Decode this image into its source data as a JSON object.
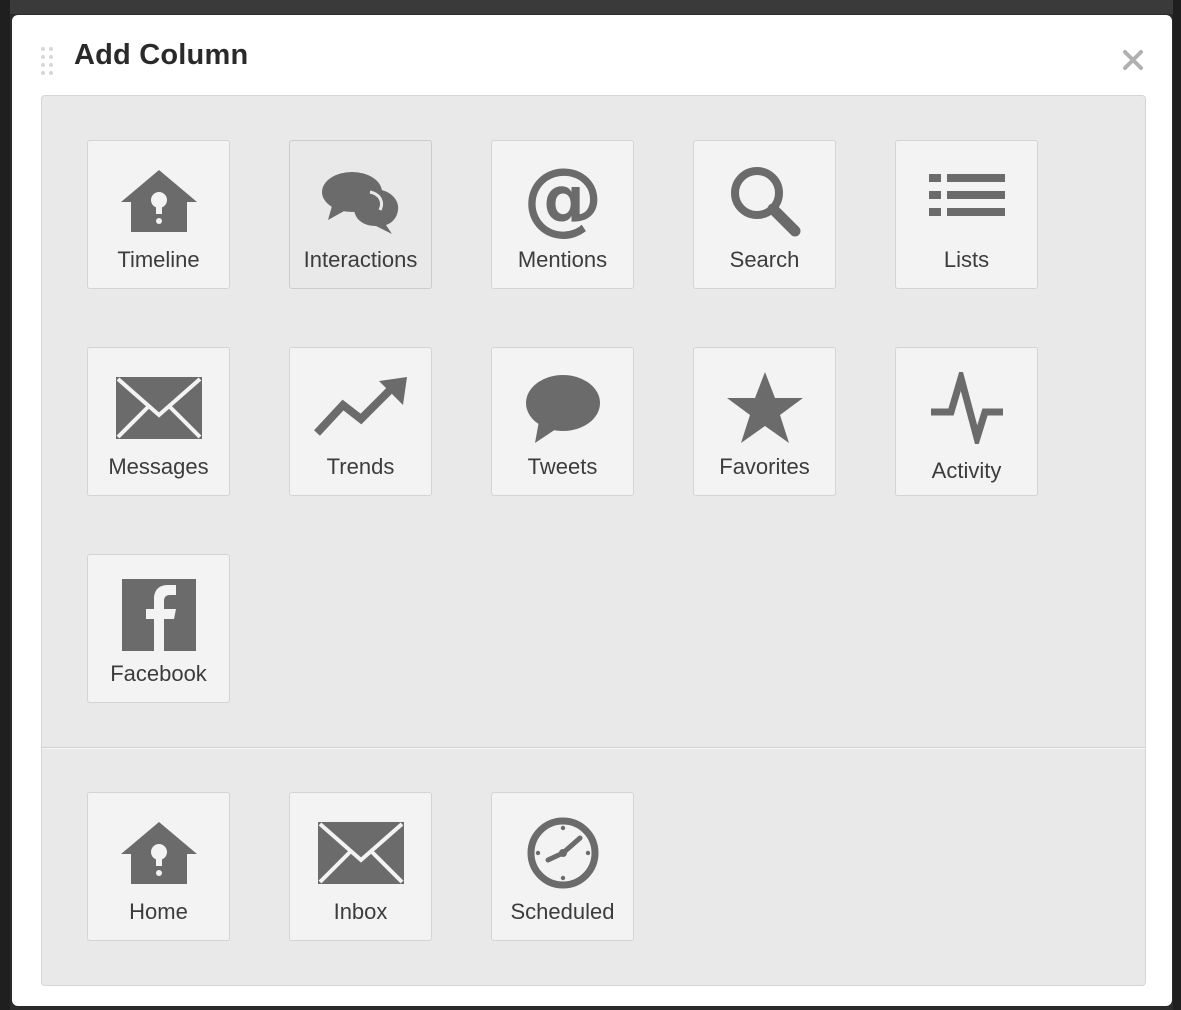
{
  "dialog": {
    "title": "Add Column"
  },
  "columns": [
    {
      "label": "Timeline",
      "icon": "home-birdhouse-icon"
    },
    {
      "label": "Interactions",
      "icon": "speech-bubbles-icon"
    },
    {
      "label": "Mentions",
      "icon": "at-sign-icon"
    },
    {
      "label": "Search",
      "icon": "search-icon"
    },
    {
      "label": "Lists",
      "icon": "list-icon"
    },
    {
      "label": "Messages",
      "icon": "envelope-icon"
    },
    {
      "label": "Trends",
      "icon": "trend-arrow-icon"
    },
    {
      "label": "Tweets",
      "icon": "speech-bubble-icon"
    },
    {
      "label": "Favorites",
      "icon": "star-icon"
    },
    {
      "label": "Activity",
      "icon": "pulse-icon"
    },
    {
      "label": "Facebook",
      "icon": "facebook-icon"
    }
  ],
  "extra_columns": [
    {
      "label": "Home",
      "icon": "home-birdhouse-icon"
    },
    {
      "label": "Inbox",
      "icon": "envelope-icon"
    },
    {
      "label": "Scheduled",
      "icon": "clock-icon"
    }
  ],
  "colors": {
    "icon": "#6b6b6b",
    "tile_bg": "#f3f3f3",
    "panel_bg": "#e9e9e9"
  }
}
